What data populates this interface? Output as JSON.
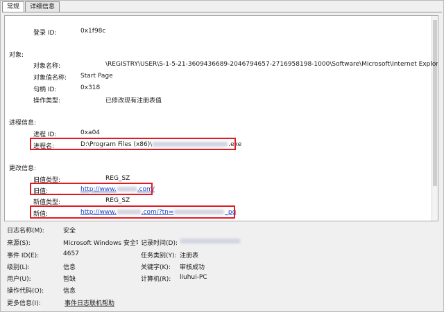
{
  "tabs": {
    "general": "常规",
    "details": "详细信息"
  },
  "event": {
    "logon_id_label": "登录 ID:",
    "logon_id_value": "0x1f98c",
    "object_section": "对象:",
    "object_name_label": "对象名称:",
    "object_name_value": "\\REGISTRY\\USER\\S-1-5-21-3609436689-2046794657-2716958198-1000\\Software\\Microsoft\\Internet Explorer\\Main",
    "object_value_name_label": "对象值名称:",
    "object_value_name_value": "Start Page",
    "handle_id_label": "句柄 ID:",
    "handle_id_value": "0x318",
    "operation_type_label": "操作类型:",
    "operation_type_value": "已修改现有注册表值",
    "process_section": "进程信息:",
    "process_id_label": "进程 ID:",
    "process_id_value": "0xa04",
    "process_name_label": "进程名:",
    "process_name_prefix": "D:\\Program Files (x86)\\",
    "process_name_suffix": ".exe",
    "change_section": "更改信息:",
    "old_type_label": "旧值类型:",
    "old_type_value": "REG_SZ",
    "old_value_label": "旧值:",
    "old_value_prefix": "http://www.",
    "old_value_suffix": ".com/",
    "new_type_label": "新值类型:",
    "new_type_value": "REG_SZ",
    "new_value_label": "新值:",
    "new_value_prefix": "http://www.",
    "new_value_middle": ".com/?tn=",
    "new_value_suffix": "_pg"
  },
  "info": {
    "log_name_label": "日志名称(M):",
    "log_name_value": "安全",
    "source_label": "来源(S):",
    "source_value": "Microsoft Windows 安全审",
    "logged_label": "记录时间(D):",
    "event_id_label": "事件 ID(E):",
    "event_id_value": "4657",
    "task_category_label": "任务类别(Y):",
    "task_category_value": "注册表",
    "level_label": "级别(L):",
    "level_value": "信息",
    "keywords_label": "关键字(K):",
    "keywords_value": "审核成功",
    "user_label": "用户(U):",
    "user_value": "暂缺",
    "computer_label": "计算机(R):",
    "computer_value": "liuhui-PC",
    "opcode_label": "操作代码(O):",
    "opcode_value": "信息",
    "more_info_label": "更多信息(I):",
    "more_info_link": "事件日志联机帮助"
  },
  "colors": {
    "highlight": "#e21b23",
    "link": "#1a3fc2"
  }
}
